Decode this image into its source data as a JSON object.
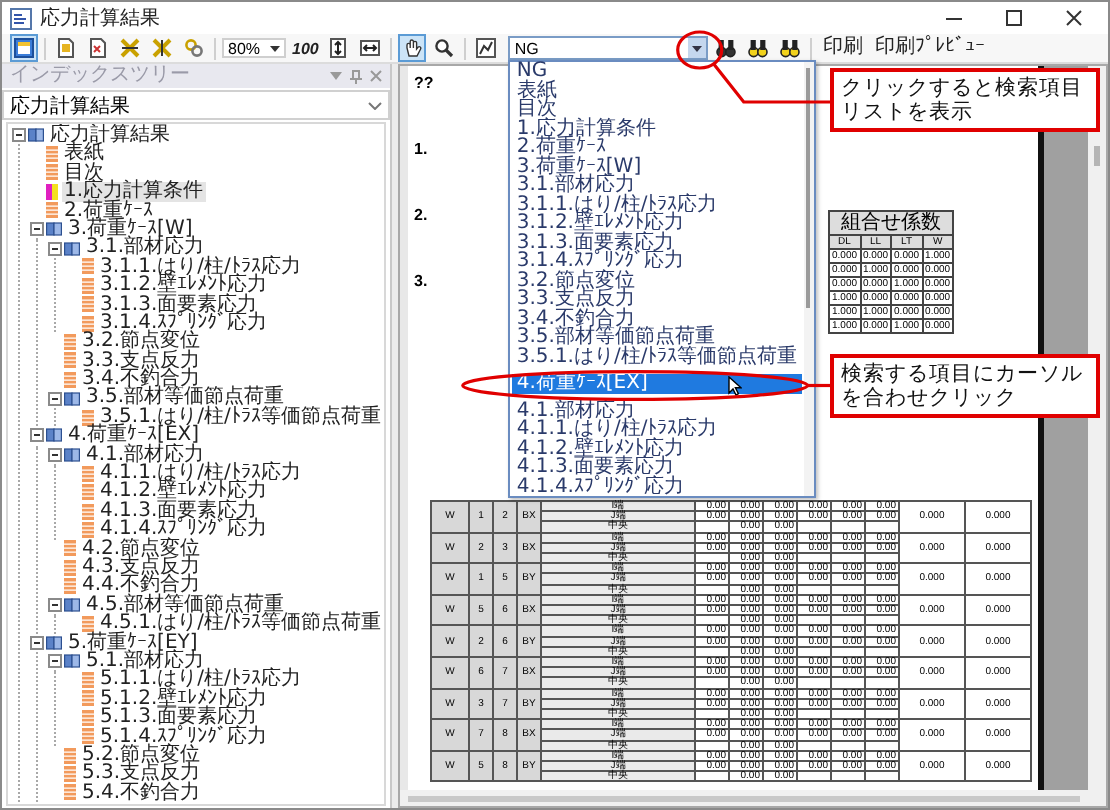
{
  "window": {
    "title": "応力計算結果"
  },
  "toolbar": {
    "layout_toggle": {
      "on": true
    },
    "zoom": "80%",
    "fit_label": "100",
    "tools": [
      {
        "kind": "hand",
        "selected": true
      },
      {
        "kind": "magnifier",
        "selected": false
      }
    ],
    "search": {
      "value": "NG"
    },
    "buttons": [
      "印刷",
      "印刷ﾌﾟﾚﾋﾞｭｰ"
    ]
  },
  "index_tree": {
    "title": "インデックスツリー",
    "selector": "応力計算結果",
    "items": [
      {
        "label": "応力計算結果",
        "selected": false,
        "expanded": true,
        "children": [
          {
            "label": "表紙",
            "selected": false
          },
          {
            "label": "目次",
            "selected": false
          },
          {
            "label": "1.応力計算条件",
            "selected": true
          },
          {
            "label": "2.荷重ｹｰｽ",
            "selected": false
          },
          {
            "label": "3.荷重ｹｰｽ[W]",
            "selected": false,
            "expanded": true,
            "children": [
              {
                "label": "3.1.部材応力",
                "selected": false,
                "expanded": true,
                "children": [
                  {
                    "label": "3.1.1.はり/柱/ﾄﾗｽ応力",
                    "selected": false
                  },
                  {
                    "label": "3.1.2.壁ｴﾚﾒﾝﾄ応力",
                    "selected": false
                  },
                  {
                    "label": "3.1.3.面要素応力",
                    "selected": false
                  },
                  {
                    "label": "3.1.4.ｽﾌﾟﾘﾝｸﾞ応力",
                    "selected": false
                  }
                ]
              },
              {
                "label": "3.2.節点変位",
                "selected": false
              },
              {
                "label": "3.3.支点反力",
                "selected": false
              },
              {
                "label": "3.4.不釣合力",
                "selected": false
              },
              {
                "label": "3.5.部材等価節点荷重",
                "selected": false,
                "expanded": true,
                "children": [
                  {
                    "label": "3.5.1.はり/柱/ﾄﾗｽ等価節点荷重",
                    "selected": false
                  }
                ]
              }
            ]
          },
          {
            "label": "4.荷重ｹｰｽ[EX]",
            "selected": false,
            "expanded": true,
            "children": [
              {
                "label": "4.1.部材応力",
                "selected": false,
                "expanded": true,
                "children": [
                  {
                    "label": "4.1.1.はり/柱/ﾄﾗｽ応力",
                    "selected": false
                  },
                  {
                    "label": "4.1.2.壁ｴﾚﾒﾝﾄ応力",
                    "selected": false
                  },
                  {
                    "label": "4.1.3.面要素応力",
                    "selected": false
                  },
                  {
                    "label": "4.1.4.ｽﾌﾟﾘﾝｸﾞ応力",
                    "selected": false
                  }
                ]
              },
              {
                "label": "4.2.節点変位",
                "selected": false
              },
              {
                "label": "4.3.支点反力",
                "selected": false
              },
              {
                "label": "4.4.不釣合力",
                "selected": false
              },
              {
                "label": "4.5.部材等価節点荷重",
                "selected": false,
                "expanded": true,
                "children": [
                  {
                    "label": "4.5.1.はり/柱/ﾄﾗｽ等価節点荷重",
                    "selected": false
                  }
                ]
              }
            ]
          },
          {
            "label": "5.荷重ｹｰｽ[EY]",
            "selected": false,
            "expanded": true,
            "children": [
              {
                "label": "5.1.部材応力",
                "selected": false,
                "expanded": true,
                "children": [
                  {
                    "label": "5.1.1.はり/柱/ﾄﾗｽ応力",
                    "selected": false
                  },
                  {
                    "label": "5.1.2.壁ｴﾚﾒﾝﾄ応力",
                    "selected": false
                  },
                  {
                    "label": "5.1.3.面要素応力",
                    "selected": false
                  },
                  {
                    "label": "5.1.4.ｽﾌﾟﾘﾝｸﾞ応力",
                    "selected": false
                  }
                ]
              },
              {
                "label": "5.2.節点変位",
                "selected": false
              },
              {
                "label": "5.3.支点反力",
                "selected": false
              },
              {
                "label": "5.4.不釣合力",
                "selected": false
              }
            ]
          }
        ]
      }
    ]
  },
  "search_list": {
    "items": [
      {
        "label": "NG",
        "selected": false
      },
      {
        "label": "表紙",
        "selected": false
      },
      {
        "label": "目次",
        "selected": false
      },
      {
        "label": "1.応力計算条件",
        "selected": false
      },
      {
        "label": "2.荷重ｹｰｽ",
        "selected": false
      },
      {
        "label": "3.荷重ｹｰｽ[W]",
        "selected": false
      },
      {
        "label": "3.1.部材応力",
        "selected": false
      },
      {
        "label": "3.1.1.はり/柱/ﾄﾗｽ応力",
        "selected": false
      },
      {
        "label": "3.1.2.壁ｴﾚﾒﾝﾄ応力",
        "selected": false
      },
      {
        "label": "3.1.3.面要素応力",
        "selected": false
      },
      {
        "label": "3.1.4.ｽﾌﾟﾘﾝｸﾞ応力",
        "selected": false
      },
      {
        "label": "3.2.節点変位",
        "selected": false
      },
      {
        "label": "3.3.支点反力",
        "selected": false
      },
      {
        "label": "3.4.不釣合力",
        "selected": false
      },
      {
        "label": "3.5.部材等価節点荷重",
        "selected": false
      },
      {
        "label": "3.5.1.はり/柱/ﾄﾗｽ等価節点荷重",
        "selected": false
      },
      {
        "label": "4.荷重ｹｰｽ[EX]",
        "selected": true
      },
      {
        "label": "4.1.部材応力",
        "selected": false
      },
      {
        "label": "4.1.1.はり/柱/ﾄﾗｽ応力",
        "selected": false
      },
      {
        "label": "4.1.2.壁ｴﾚﾒﾝﾄ応力",
        "selected": false
      },
      {
        "label": "4.1.3.面要素応力",
        "selected": false
      },
      {
        "label": "4.1.4.ｽﾌﾟﾘﾝｸﾞ応力",
        "selected": false
      }
    ]
  },
  "document": {
    "headings": [
      "??",
      "1.",
      "2.",
      "3."
    ],
    "combination_table": {
      "title": "組合せ係数",
      "columns": [
        "DL",
        "LL",
        "LT",
        "W"
      ],
      "rows": [
        [
          "0.000",
          "0.000",
          "0.000",
          "1.000"
        ],
        [
          "0.000",
          "1.000",
          "0.000",
          "0.000"
        ],
        [
          "0.000",
          "0.000",
          "1.000",
          "0.000"
        ],
        [
          "1.000",
          "0.000",
          "0.000",
          "0.000"
        ],
        [
          "1.000",
          "1.000",
          "0.000",
          "0.000"
        ],
        [
          "1.000",
          "0.000",
          "1.000",
          "0.000"
        ]
      ]
    },
    "member_table": {
      "rows": [
        {
          "case": "W",
          "node_i": "1",
          "node_j": "2",
          "axis": "BX",
          "sections": [
            {
              "kind": "end",
              "label": "I端",
              "values": [
                "0.00",
                "0.00",
                "0.00",
                "0.00",
                "0.00",
                "0.00"
              ]
            },
            {
              "kind": "end",
              "label": "J端",
              "values": [
                "0.00",
                "0.00",
                "0.00",
                "0.00",
                "0.00",
                "0.00"
              ]
            },
            {
              "kind": "center",
              "label": "中央",
              "values": [
                "0.00",
                "0.00"
              ]
            }
          ],
          "results": [
            "0.000",
            "0.000"
          ]
        },
        {
          "case": "W",
          "node_i": "2",
          "node_j": "3",
          "axis": "BX",
          "sections": [
            {
              "kind": "end",
              "label": "I端",
              "values": [
                "0.00",
                "0.00",
                "0.00",
                "0.00",
                "0.00",
                "0.00"
              ]
            },
            {
              "kind": "end",
              "label": "J端",
              "values": [
                "0.00",
                "0.00",
                "0.00",
                "0.00",
                "0.00",
                "0.00"
              ]
            },
            {
              "kind": "center",
              "label": "中央",
              "values": [
                "0.00",
                "0.00"
              ]
            }
          ],
          "results": [
            "0.000",
            "0.000"
          ]
        },
        {
          "case": "W",
          "node_i": "1",
          "node_j": "5",
          "axis": "BY",
          "sections": [
            {
              "kind": "end",
              "label": "I端",
              "values": [
                "0.00",
                "0.00",
                "0.00",
                "0.00",
                "0.00",
                "0.00"
              ]
            },
            {
              "kind": "end",
              "label": "J端",
              "values": [
                "0.00",
                "0.00",
                "0.00",
                "0.00",
                "0.00",
                "0.00"
              ]
            },
            {
              "kind": "center",
              "label": "中央",
              "values": [
                "0.00",
                "0.00"
              ]
            }
          ],
          "results": [
            "0.000",
            "0.000"
          ]
        },
        {
          "case": "W",
          "node_i": "5",
          "node_j": "6",
          "axis": "BX",
          "sections": [
            {
              "kind": "end",
              "label": "I端",
              "values": [
                "0.00",
                "0.00",
                "0.00",
                "0.00",
                "0.00",
                "0.00"
              ]
            },
            {
              "kind": "end",
              "label": "J端",
              "values": [
                "0.00",
                "0.00",
                "0.00",
                "0.00",
                "0.00",
                "0.00"
              ]
            },
            {
              "kind": "center",
              "label": "中央",
              "values": [
                "0.00",
                "0.00"
              ]
            }
          ],
          "results": [
            "0.000",
            "0.000"
          ]
        },
        {
          "case": "W",
          "node_i": "2",
          "node_j": "6",
          "axis": "BY",
          "sections": [
            {
              "kind": "end",
              "label": "I端",
              "values": [
                "0.00",
                "0.00",
                "0.00",
                "0.00",
                "0.00",
                "0.00"
              ]
            },
            {
              "kind": "end",
              "label": "J端",
              "values": [
                "0.00",
                "0.00",
                "0.00",
                "0.00",
                "0.00",
                "0.00"
              ]
            },
            {
              "kind": "center",
              "label": "中央",
              "values": [
                "0.00",
                "0.00"
              ]
            }
          ],
          "results": [
            "0.000",
            "0.000"
          ]
        },
        {
          "case": "W",
          "node_i": "6",
          "node_j": "7",
          "axis": "BX",
          "sections": [
            {
              "kind": "end",
              "label": "I端",
              "values": [
                "0.00",
                "0.00",
                "0.00",
                "0.00",
                "0.00",
                "0.00"
              ]
            },
            {
              "kind": "end",
              "label": "J端",
              "values": [
                "0.00",
                "0.00",
                "0.00",
                "0.00",
                "0.00",
                "0.00"
              ]
            },
            {
              "kind": "center",
              "label": "中央",
              "values": [
                "0.00",
                "0.00"
              ]
            }
          ],
          "results": [
            "0.000",
            "0.000"
          ]
        },
        {
          "case": "W",
          "node_i": "3",
          "node_j": "7",
          "axis": "BY",
          "sections": [
            {
              "kind": "end",
              "label": "I端",
              "values": [
                "0.00",
                "0.00",
                "0.00",
                "0.00",
                "0.00",
                "0.00"
              ]
            },
            {
              "kind": "end",
              "label": "J端",
              "values": [
                "0.00",
                "0.00",
                "0.00",
                "0.00",
                "0.00",
                "0.00"
              ]
            },
            {
              "kind": "center",
              "label": "中央",
              "values": [
                "0.00",
                "0.00"
              ]
            }
          ],
          "results": [
            "0.000",
            "0.000"
          ]
        },
        {
          "case": "W",
          "node_i": "7",
          "node_j": "8",
          "axis": "BX",
          "sections": [
            {
              "kind": "end",
              "label": "I端",
              "values": [
                "0.00",
                "0.00",
                "0.00",
                "0.00",
                "0.00",
                "0.00"
              ]
            },
            {
              "kind": "end",
              "label": "J端",
              "values": [
                "0.00",
                "0.00",
                "0.00",
                "0.00",
                "0.00",
                "0.00"
              ]
            },
            {
              "kind": "center",
              "label": "中央",
              "values": [
                "0.00",
                "0.00"
              ]
            }
          ],
          "results": [
            "0.000",
            "0.000"
          ]
        },
        {
          "case": "W",
          "node_i": "5",
          "node_j": "8",
          "axis": "BY",
          "sections": [
            {
              "kind": "end",
              "label": "I端",
              "values": [
                "0.00",
                "0.00",
                "0.00",
                "0.00",
                "0.00",
                "0.00"
              ]
            },
            {
              "kind": "end",
              "label": "J端",
              "values": [
                "0.00",
                "0.00",
                "0.00",
                "0.00",
                "0.00",
                "0.00"
              ]
            },
            {
              "kind": "center",
              "label": "中央",
              "values": [
                "0.00",
                "0.00"
              ]
            }
          ],
          "results": [
            "0.000",
            "0.000"
          ]
        }
      ]
    }
  },
  "callouts": [
    {
      "text": "クリックすると検索項目リストを表示"
    },
    {
      "text": "検索する項目にカーソルを合わせクリック"
    }
  ]
}
